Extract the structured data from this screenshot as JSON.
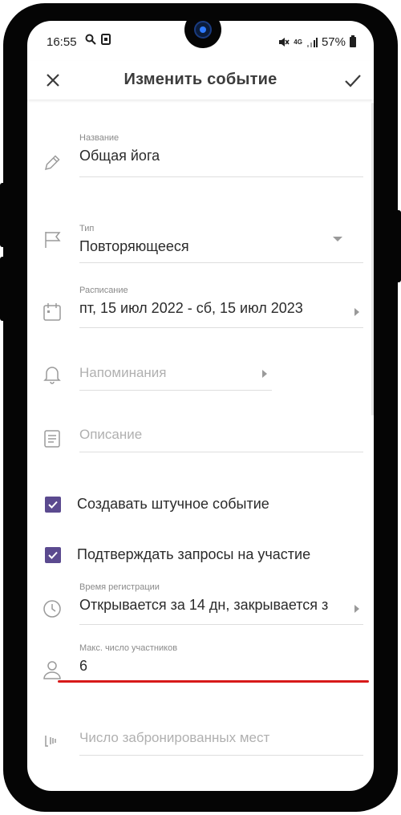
{
  "status_bar": {
    "time": "16:55",
    "network": "4G",
    "battery": "57%"
  },
  "app_bar": {
    "title": "Изменить событие",
    "close_icon": "close-icon",
    "confirm_icon": "check-icon"
  },
  "form": {
    "name": {
      "label": "Название",
      "value": "Общая йога"
    },
    "type": {
      "label": "Тип",
      "value": "Повторяющееся"
    },
    "schedule": {
      "label": "Расписание",
      "value": "пт, 15 июл 2022 - сб, 15 июл 2023"
    },
    "reminders": {
      "placeholder": "Напоминания"
    },
    "description": {
      "placeholder": "Описание"
    },
    "create_single_event": {
      "label": "Создавать штучное событие",
      "checked": true
    },
    "confirm_requests": {
      "label": "Подтверждать запросы на участие",
      "checked": true
    },
    "registration_time": {
      "label": "Время регистрации",
      "value": "Открывается за 14 дн, закрывается з"
    },
    "max_participants": {
      "label": "Макс. число участников",
      "value": "6"
    },
    "booked_seats": {
      "placeholder": "Число забронированных мест"
    }
  },
  "colors": {
    "accent": "#5b4a8f",
    "annotation_red": "#d71919"
  }
}
